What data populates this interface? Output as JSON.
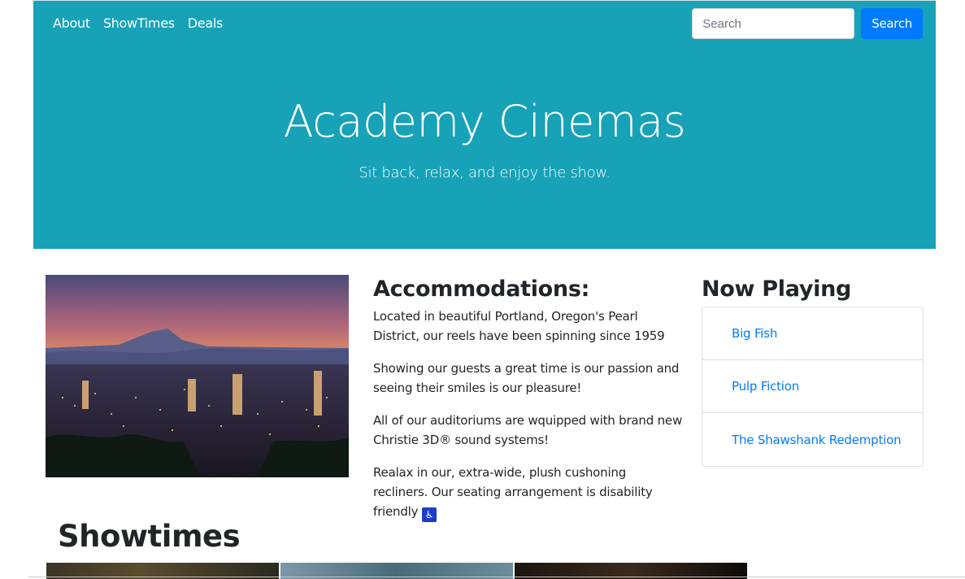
{
  "nav": {
    "links": [
      "About",
      "ShowTimes",
      "Deals"
    ],
    "search_placeholder": "Search",
    "search_button": "Search"
  },
  "hero": {
    "title": "Academy Cinemas",
    "subtitle": "Sit back, relax, and enjoy the show."
  },
  "accommodations": {
    "heading": "Accommodations:",
    "paragraphs": [
      "Located in beautiful Portland, Oregon's Pearl District, our reels have been spinning since 1959",
      "Showing our guests a great time is our passion and seeing their smiles is our pleasure!",
      "All of our auditoriums are wquipped with brand new Christie 3D® sound systems!",
      "Realax in our, extra-wide, plush cushoning recliners. Our seating arrangement is disability friendly"
    ],
    "accessibility_icon": "wheelchair-icon"
  },
  "now_playing": {
    "heading": "Now Playing",
    "movies": [
      "Big Fish",
      "Pulp Fiction",
      "The Shawshank Redemption"
    ]
  },
  "showtimes": {
    "heading": "Showtimes"
  },
  "colors": {
    "hero_bg": "#17a2b8",
    "primary": "#007bff"
  }
}
